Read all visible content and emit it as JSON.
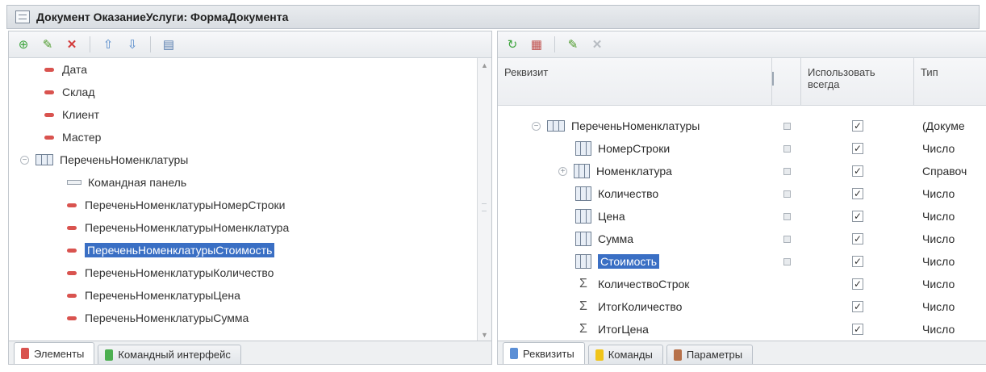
{
  "window": {
    "title": "Документ ОказаниеУслуги: ФормаДокумента"
  },
  "icons": {
    "window": "form-icon",
    "left_toolbar": [
      "add-icon",
      "edit-icon",
      "delete-icon",
      "move-up-icon",
      "move-down-icon",
      "form-list-icon"
    ],
    "right_toolbar": [
      "add-attribute-icon",
      "add-table-icon",
      "edit-icon",
      "delete-icon"
    ]
  },
  "colors": {
    "selection": "#3a6fc4",
    "attribute_icon": "#d9534f"
  },
  "left_panel": {
    "items": [
      {
        "label": "Дата",
        "kind": "attr",
        "level": 0
      },
      {
        "label": "Склад",
        "kind": "attr",
        "level": 0
      },
      {
        "label": "Клиент",
        "kind": "attr",
        "level": 0
      },
      {
        "label": "Мастер",
        "kind": "attr",
        "level": 0
      },
      {
        "label": "ПереченьНоменклатуры",
        "kind": "table",
        "level": 0
      },
      {
        "label": "Командная панель",
        "kind": "cmd",
        "level": 1
      },
      {
        "label": "ПереченьНоменклатурыНомерСтроки",
        "kind": "attr",
        "level": 1
      },
      {
        "label": "ПереченьНоменклатурыНоменклатура",
        "kind": "attr",
        "level": 1
      },
      {
        "label": "ПереченьНоменклатурыСтоимость",
        "kind": "attr",
        "level": 1,
        "selected": true
      },
      {
        "label": "ПереченьНоменклатурыКоличество",
        "kind": "attr",
        "level": 1
      },
      {
        "label": "ПереченьНоменклатурыЦена",
        "kind": "attr",
        "level": 1
      },
      {
        "label": "ПереченьНоменклатурыСумма",
        "kind": "attr",
        "level": 1
      }
    ],
    "tabs": [
      {
        "label": "Элементы",
        "active": true
      },
      {
        "label": "Командный интерфейс",
        "active": false
      }
    ]
  },
  "right_panel": {
    "columns": {
      "name": "Реквизит",
      "always_use": "Использовать всегда",
      "type": "Тип"
    },
    "rows": [
      {
        "name": "ПереченьНоменклатуры",
        "icon": "table",
        "dot": true,
        "checked": true,
        "type": "(Докуме"
      },
      {
        "name": "НомерСтроки",
        "icon": "col",
        "dot": true,
        "checked": true,
        "type": "Число"
      },
      {
        "name": "Номенклатура",
        "icon": "col",
        "dot": true,
        "checked": true,
        "type": "Справоч",
        "expandable": true
      },
      {
        "name": "Количество",
        "icon": "col",
        "dot": true,
        "checked": true,
        "type": "Число"
      },
      {
        "name": "Цена",
        "icon": "col",
        "dot": true,
        "checked": true,
        "type": "Число"
      },
      {
        "name": "Сумма",
        "icon": "col",
        "dot": true,
        "checked": true,
        "type": "Число"
      },
      {
        "name": "Стоимость",
        "icon": "col",
        "dot": true,
        "checked": true,
        "type": "Число",
        "selected": true
      },
      {
        "name": "КоличествоСтрок",
        "icon": "sum",
        "dot": false,
        "checked": true,
        "type": "Число"
      },
      {
        "name": "ИтогКоличество",
        "icon": "sum",
        "dot": false,
        "checked": true,
        "type": "Число"
      },
      {
        "name": "ИтогЦена",
        "icon": "sum",
        "dot": false,
        "checked": true,
        "type": "Число"
      }
    ],
    "tabs": [
      {
        "label": "Реквизиты",
        "active": true
      },
      {
        "label": "Команды",
        "active": false
      },
      {
        "label": "Параметры",
        "active": false
      }
    ]
  }
}
